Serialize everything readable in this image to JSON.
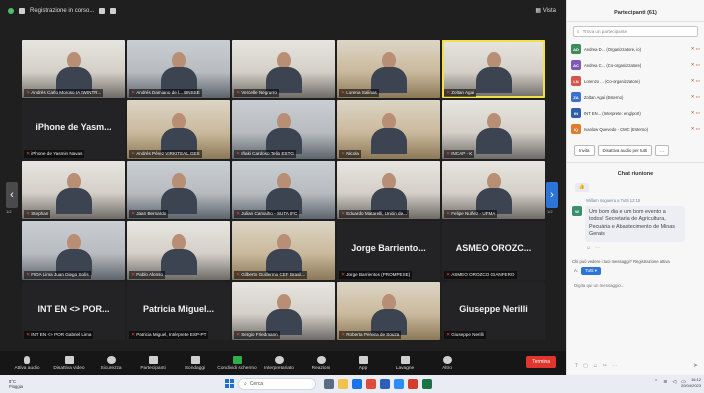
{
  "window": {
    "title": "Registrazione in corso...",
    "view_label": "Vista"
  },
  "tiles": [
    {
      "name": "Andrés Carlo Moroso IA IWINTR...",
      "style": "v2",
      "mic_off": true
    },
    {
      "name": "Andrés Damiano de l... BNSSE",
      "style": "v3",
      "mic_off": true
    },
    {
      "name": "Vercelle Negrurro",
      "style": "v2",
      "mic_off": true
    },
    {
      "name": "Lorena Salinas",
      "style": "v4",
      "mic_off": true
    },
    {
      "name": "Zoltan Agai",
      "style": "v2",
      "mic_off": true,
      "active": true
    },
    {
      "big": "iPhone de Yasm...",
      "name": "iPhone de Yasmin Navas",
      "mic_off": true
    },
    {
      "name": "Andrés Pérez VIRKITEAL GES",
      "style": "v4",
      "mic_off": true
    },
    {
      "name": "Iñaki Cardoso Tello ESTG",
      "style": "v3",
      "mic_off": true
    },
    {
      "name": "Nicola",
      "style": "v4",
      "mic_off": true
    },
    {
      "name": "INCAP - K",
      "style": "v2",
      "mic_off": true
    },
    {
      "name": "Stephan",
      "style": "v2",
      "mic_off": true
    },
    {
      "name": "Jaan Bernardo",
      "style": "v3",
      "mic_off": true
    },
    {
      "name": "Julian Carvalho - SUTA IFC",
      "style": "v3",
      "mic_off": true
    },
    {
      "name": "Eduardo Matarelli, Unión de...",
      "style": "v2",
      "mic_off": true
    },
    {
      "name": "Felipe Nuñez - UFMA",
      "style": "v2",
      "mic_off": true
    },
    {
      "name": "FIDA Lima Juan Diego Solís",
      "style": "v3",
      "mic_off": true
    },
    {
      "name": "Pablo Alonso",
      "style": "v2",
      "mic_off": true
    },
    {
      "name": "Gilberto Guillermo CEF Brasil...",
      "style": "v4",
      "mic_off": true
    },
    {
      "big": "Jorge Barriento...",
      "name": "Jorge Barrientos (PROMPESE)",
      "mic_off": true
    },
    {
      "big": "ASMEO OROZC...",
      "name": "ASMEO OROZCO GIANFERO",
      "mic_off": true
    },
    {
      "big": "INT EN <> POR...",
      "name": "INT EN <> POR Gabriel Lima",
      "mic_off": true
    },
    {
      "big": "Patricia Miguel...",
      "name": "Patricia Miguel, Intérprete ESP-PT",
      "mic_off": true
    },
    {
      "name": "Sergio Friedmann",
      "style": "v2",
      "mic_off": true
    },
    {
      "name": "Roberta Pereira de Souza",
      "style": "v4",
      "mic_off": true
    },
    {
      "big": "Giuseppe Nerilli",
      "name": "Giuseppe Nerilli",
      "mic_off": true
    }
  ],
  "pager": {
    "left": "1/2",
    "right": "1/2"
  },
  "toolbar": [
    {
      "label": "Attiva audio",
      "icon": "mic-icon",
      "cls": "mic"
    },
    {
      "label": "Disattiva video",
      "icon": "video-icon",
      "cls": ""
    },
    {
      "label": "Sicurezza",
      "icon": "shield-icon",
      "cls": "round"
    },
    {
      "label": "Partecipanti",
      "icon": "participants-icon",
      "cls": ""
    },
    {
      "label": "Sondaggi",
      "icon": "poll-icon",
      "cls": ""
    },
    {
      "label": "Condividi schermo",
      "icon": "share-screen-icon",
      "cls": "green"
    },
    {
      "label": "Interpretariato",
      "icon": "globe-icon",
      "cls": "round"
    },
    {
      "label": "Reazioni",
      "icon": "reaction-icon",
      "cls": "round"
    },
    {
      "label": "App",
      "icon": "apps-icon",
      "cls": ""
    },
    {
      "label": "Lavagne",
      "icon": "whiteboard-icon",
      "cls": ""
    },
    {
      "label": "Altro",
      "icon": "more-icon",
      "cls": "round"
    }
  ],
  "end_label": "Termina",
  "panel": {
    "title": "Partecipanti (61)",
    "search_placeholder": "Trova un partecipante",
    "participants": [
      {
        "initials": "AD",
        "name": "Andrea D... (Organizzatore, io)",
        "color": "#3f8a5a"
      },
      {
        "initials": "AC",
        "name": "Andrea C... (Co-organizzatore)",
        "color": "#7d5bb5"
      },
      {
        "initials": "LN",
        "name": "Lorenzo ... (Co-organizzatore)",
        "color": "#d6574a"
      },
      {
        "initials": "ZA",
        "name": "Zoltan Agai (Esterno)",
        "color": "#3d6fcf"
      },
      {
        "initials": "IN",
        "name": "INT EN... (Interprete: eng/port)",
        "color": "#2f5fa8"
      },
      {
        "initials": "IQ",
        "name": "Ivanlow Quevedo - CMC (Esterno)",
        "color": "#e07b2e"
      }
    ],
    "invite_label": "Invita",
    "mute_all_label": "Disattiva audio per tutti",
    "more_label": "..."
  },
  "chat": {
    "title": "Chat riunione",
    "reaction": "👍",
    "sender": "Willam nogueira a Tutti 12:15",
    "message": "Um bom dia e um bom evento a todos! Secretaria de Agricultura, Pecuária e Abastecimento de Minas Gerais",
    "who_can_see": "Chi può vedere i tuoi messaggi? Registrazione attiva",
    "to_label": "A:",
    "to_target": "Tutti ▾",
    "input_placeholder": "Digita qui un messaggio..."
  },
  "taskbar": {
    "temp": "8°C",
    "weather": "Pioggia",
    "search": "Cerca",
    "time": "16:12",
    "date": "20/04/2023"
  }
}
